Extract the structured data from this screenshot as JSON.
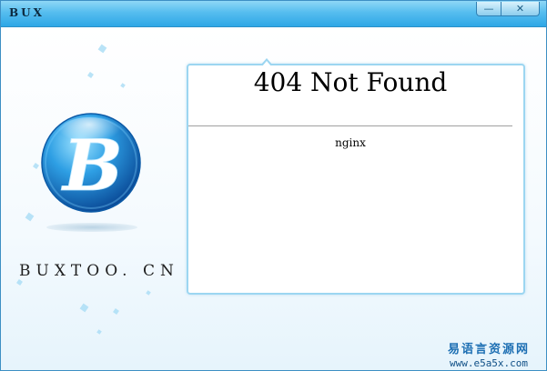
{
  "window": {
    "title": "BUX",
    "minimize_symbol": "—",
    "close_symbol": "✕",
    "titlebar_color": "#3aaee9"
  },
  "brand": {
    "logo_letter": "B",
    "logo_icon": "bux-globe-logo-icon",
    "site_text": "BUXTOO. CN",
    "accent_color": "#1a86d4"
  },
  "error_page": {
    "title": "404 Not Found",
    "server": "nginx"
  },
  "watermark": {
    "chinese_text": "易语言资源网",
    "url": "www.e5a5x.com"
  }
}
